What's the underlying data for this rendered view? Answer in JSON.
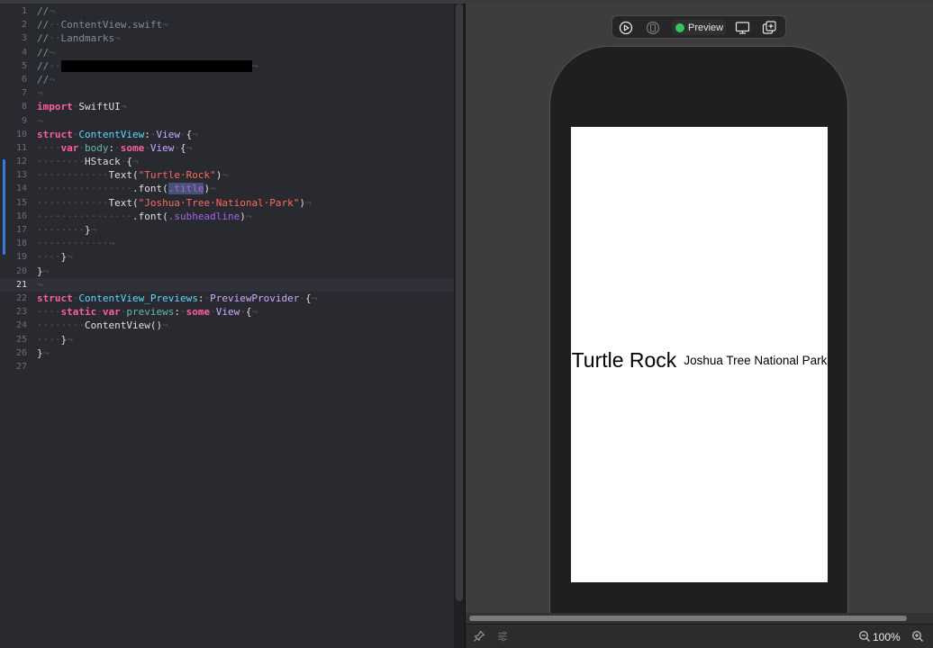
{
  "editor": {
    "lines": [
      {
        "n": "1",
        "tokens": [
          {
            "c": "cm",
            "t": "//"
          },
          {
            "c": "ws",
            "t": "¬"
          }
        ]
      },
      {
        "n": "2",
        "tokens": [
          {
            "c": "cm",
            "t": "//"
          },
          {
            "c": "ws",
            "t": "··"
          },
          {
            "c": "cm",
            "t": "ContentView.swift"
          },
          {
            "c": "ws",
            "t": "¬"
          }
        ]
      },
      {
        "n": "3",
        "tokens": [
          {
            "c": "cm",
            "t": "//"
          },
          {
            "c": "ws",
            "t": "··"
          },
          {
            "c": "cm",
            "t": "Landmarks"
          },
          {
            "c": "ws",
            "t": "¬"
          }
        ]
      },
      {
        "n": "4",
        "tokens": [
          {
            "c": "cm",
            "t": "//"
          },
          {
            "c": "ws",
            "t": "¬"
          }
        ]
      },
      {
        "n": "5",
        "tokens": [
          {
            "c": "cm",
            "t": "//"
          },
          {
            "c": "ws",
            "t": "··"
          },
          {
            "c": "redact",
            "t": ""
          },
          {
            "c": "ws",
            "t": "¬"
          }
        ]
      },
      {
        "n": "6",
        "tokens": [
          {
            "c": "cm",
            "t": "//"
          },
          {
            "c": "ws",
            "t": "¬"
          }
        ]
      },
      {
        "n": "7",
        "tokens": [
          {
            "c": "ws",
            "t": "¬"
          }
        ]
      },
      {
        "n": "8",
        "tokens": [
          {
            "c": "kw",
            "t": "import"
          },
          {
            "c": "ws",
            "t": "·"
          },
          {
            "c": "pl",
            "t": "SwiftUI"
          },
          {
            "c": "ws",
            "t": "¬"
          }
        ]
      },
      {
        "n": "9",
        "tokens": [
          {
            "c": "ws",
            "t": "¬"
          }
        ]
      },
      {
        "n": "10",
        "tokens": [
          {
            "c": "kw",
            "t": "struct"
          },
          {
            "c": "ws",
            "t": "·"
          },
          {
            "c": "ty",
            "t": "ContentView"
          },
          {
            "c": "pl",
            "t": ":"
          },
          {
            "c": "ws",
            "t": "·"
          },
          {
            "c": "tp",
            "t": "View"
          },
          {
            "c": "ws",
            "t": "·"
          },
          {
            "c": "pl",
            "t": "{"
          },
          {
            "c": "ws",
            "t": "¬"
          }
        ]
      },
      {
        "n": "11",
        "tokens": [
          {
            "c": "ws",
            "t": "····"
          },
          {
            "c": "kw",
            "t": "var"
          },
          {
            "c": "ws",
            "t": "·"
          },
          {
            "c": "fn",
            "t": "body"
          },
          {
            "c": "pl",
            "t": ":"
          },
          {
            "c": "ws",
            "t": "·"
          },
          {
            "c": "kw",
            "t": "some"
          },
          {
            "c": "ws",
            "t": "·"
          },
          {
            "c": "tp",
            "t": "View"
          },
          {
            "c": "ws",
            "t": "·"
          },
          {
            "c": "pl",
            "t": "{"
          },
          {
            "c": "ws",
            "t": "¬"
          }
        ]
      },
      {
        "n": "12",
        "tokens": [
          {
            "c": "ws",
            "t": "········"
          },
          {
            "c": "pl",
            "t": "HStack"
          },
          {
            "c": "ws",
            "t": "·"
          },
          {
            "c": "pl",
            "t": "{"
          },
          {
            "c": "ws",
            "t": "¬"
          }
        ]
      },
      {
        "n": "13",
        "tokens": [
          {
            "c": "ws",
            "t": "············"
          },
          {
            "c": "pl",
            "t": "Text("
          },
          {
            "c": "st",
            "t": "\"Turtle·Rock\""
          },
          {
            "c": "pl",
            "t": ")"
          },
          {
            "c": "ws",
            "t": "¬"
          }
        ]
      },
      {
        "n": "14",
        "tokens": [
          {
            "c": "ws",
            "t": "················"
          },
          {
            "c": "pl",
            "t": ".font("
          },
          {
            "c": "sel",
            "t": ".title"
          },
          {
            "c": "pl",
            "t": ")"
          },
          {
            "c": "ws",
            "t": "¬"
          }
        ]
      },
      {
        "n": "15",
        "tokens": [
          {
            "c": "ws",
            "t": "············"
          },
          {
            "c": "pl",
            "t": "Text("
          },
          {
            "c": "st",
            "t": "\"Joshua·Tree·National·Park\""
          },
          {
            "c": "pl",
            "t": ")"
          },
          {
            "c": "ws",
            "t": "¬"
          }
        ]
      },
      {
        "n": "16",
        "tokens": [
          {
            "c": "ws",
            "t": "················"
          },
          {
            "c": "pl",
            "t": ".font("
          },
          {
            "c": "pr",
            "t": ".subheadline"
          },
          {
            "c": "pl",
            "t": ")"
          },
          {
            "c": "ws",
            "t": "¬"
          }
        ]
      },
      {
        "n": "17",
        "tokens": [
          {
            "c": "ws",
            "t": "········"
          },
          {
            "c": "pl",
            "t": "}"
          },
          {
            "c": "ws",
            "t": "¬"
          }
        ]
      },
      {
        "n": "18",
        "tokens": [
          {
            "c": "ws",
            "t": "············¬"
          }
        ]
      },
      {
        "n": "19",
        "tokens": [
          {
            "c": "ws",
            "t": "····"
          },
          {
            "c": "pl",
            "t": "}"
          },
          {
            "c": "ws",
            "t": "¬"
          }
        ]
      },
      {
        "n": "20",
        "tokens": [
          {
            "c": "pl",
            "t": "}"
          },
          {
            "c": "ws",
            "t": "¬"
          }
        ]
      },
      {
        "n": "21",
        "current": true,
        "tokens": [
          {
            "c": "ws",
            "t": "¬"
          }
        ]
      },
      {
        "n": "22",
        "tokens": [
          {
            "c": "kw",
            "t": "struct"
          },
          {
            "c": "ws",
            "t": "·"
          },
          {
            "c": "ty",
            "t": "ContentView_Previews"
          },
          {
            "c": "pl",
            "t": ":"
          },
          {
            "c": "ws",
            "t": "·"
          },
          {
            "c": "tp",
            "t": "PreviewProvider"
          },
          {
            "c": "ws",
            "t": "·"
          },
          {
            "c": "pl",
            "t": "{"
          },
          {
            "c": "ws",
            "t": "¬"
          }
        ]
      },
      {
        "n": "23",
        "tokens": [
          {
            "c": "ws",
            "t": "····"
          },
          {
            "c": "kw",
            "t": "static"
          },
          {
            "c": "ws",
            "t": "·"
          },
          {
            "c": "kw",
            "t": "var"
          },
          {
            "c": "ws",
            "t": "·"
          },
          {
            "c": "fn",
            "t": "previews"
          },
          {
            "c": "pl",
            "t": ":"
          },
          {
            "c": "ws",
            "t": "·"
          },
          {
            "c": "kw",
            "t": "some"
          },
          {
            "c": "ws",
            "t": "·"
          },
          {
            "c": "tp",
            "t": "View"
          },
          {
            "c": "ws",
            "t": "·"
          },
          {
            "c": "pl",
            "t": "{"
          },
          {
            "c": "ws",
            "t": "¬"
          }
        ]
      },
      {
        "n": "24",
        "tokens": [
          {
            "c": "ws",
            "t": "········"
          },
          {
            "c": "pl",
            "t": "ContentView()"
          },
          {
            "c": "ws",
            "t": "¬"
          }
        ]
      },
      {
        "n": "25",
        "tokens": [
          {
            "c": "ws",
            "t": "····"
          },
          {
            "c": "pl",
            "t": "}"
          },
          {
            "c": "ws",
            "t": "¬"
          }
        ]
      },
      {
        "n": "26",
        "tokens": [
          {
            "c": "pl",
            "t": "}"
          },
          {
            "c": "ws",
            "t": "¬"
          }
        ]
      },
      {
        "n": "27",
        "tokens": []
      }
    ]
  },
  "preview": {
    "toolbar": {
      "live_icon": "play-circle-icon",
      "select_icon": "selectable-icon",
      "preview_label": "Preview",
      "status_color": "#34c759",
      "device_icon": "device-settings-icon",
      "duplicate_icon": "duplicate-preview-icon"
    },
    "screen": {
      "title_text": "Turtle Rock",
      "subtitle_text": "Joshua Tree National Park"
    }
  },
  "bottombar": {
    "pin_icon": "pin-icon",
    "variants_icon": "variants-icon",
    "zoom_label": "100%",
    "zoom_out_icon": "zoom-out-icon",
    "zoom_in_icon": "zoom-in-icon"
  },
  "colors": {
    "keyword": "#fc5fa3",
    "type_decl": "#5dd8ff",
    "type_ref": "#d0a8ff",
    "string": "#fc6a5d",
    "comment": "#7f8c98",
    "change_bar": "#3b7bd8"
  }
}
